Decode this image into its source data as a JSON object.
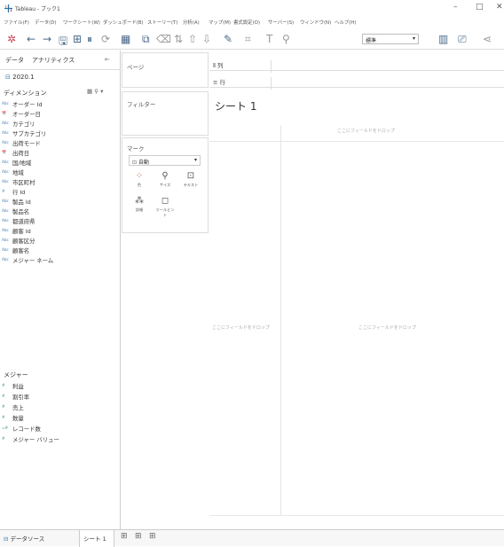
{
  "window": {
    "title": "Tableau - ブック1",
    "minimize": "–",
    "maximize": "□",
    "close": "✕"
  },
  "menu": [
    "ファイル(F)",
    "データ(D)",
    "ワークシート(W)",
    "ダッシュボード(B)",
    "ストーリー(T)",
    "分析(A)",
    "マップ(M)",
    "書式設定(O)",
    "サーバー(S)",
    "ウィンドウ(N)",
    "ヘルプ(H)"
  ],
  "toolbar": {
    "fit_select": "標準"
  },
  "left": {
    "tab_data": "データ",
    "tab_analytics": "アナリティクス",
    "source": "2020.1",
    "dimensions_header": "ディメンション",
    "measures_header": "メジャー",
    "dimensions": [
      {
        "type": "Abc",
        "name": "オーダー Id"
      },
      {
        "type": "📅",
        "name": "オーダー日"
      },
      {
        "type": "Abc",
        "name": "カテゴリ"
      },
      {
        "type": "Abc",
        "name": "サブカテゴリ"
      },
      {
        "type": "Abc",
        "name": "出荷モード"
      },
      {
        "type": "📅",
        "name": "出荷日"
      },
      {
        "type": "Abc",
        "name": "国/地域"
      },
      {
        "type": "Abc",
        "name": "地域"
      },
      {
        "type": "Abc",
        "name": "市区町村"
      },
      {
        "type": "#",
        "name": "行 Id"
      },
      {
        "type": "Abc",
        "name": "製品 Id"
      },
      {
        "type": "Abc",
        "name": "製品名"
      },
      {
        "type": "Abc",
        "name": "都道府県"
      },
      {
        "type": "Abc",
        "name": "顧客 Id"
      },
      {
        "type": "Abc",
        "name": "顧客区分"
      },
      {
        "type": "Abc",
        "name": "顧客名"
      },
      {
        "type": "Abc",
        "name": "メジャー ネーム"
      }
    ],
    "measures": [
      {
        "type": "#",
        "name": "利益"
      },
      {
        "type": "#",
        "name": "割引率"
      },
      {
        "type": "#",
        "name": "売上"
      },
      {
        "type": "#",
        "name": "数量"
      },
      {
        "type": "=#",
        "name": "レコード数"
      },
      {
        "type": "#",
        "name": "メジャー バリュー"
      }
    ]
  },
  "mid": {
    "pages": "ページ",
    "filters": "フィルター",
    "marks": "マーク",
    "mark_type": "自動",
    "mark_buttons": [
      "色",
      "サイズ",
      "テキスト",
      "詳細",
      "ツールヒント"
    ]
  },
  "shelves": {
    "columns": "列",
    "rows": "行"
  },
  "canvas": {
    "sheet_title": "シート 1",
    "drop_top": "ここにフィールドをドロップ",
    "drop_left": "ここにフィールドをドロップ",
    "drop_center": "ここにフィールドをドロップ"
  },
  "bottom": {
    "datasource_tab": "データソース",
    "sheet_tab": "シート 1"
  }
}
